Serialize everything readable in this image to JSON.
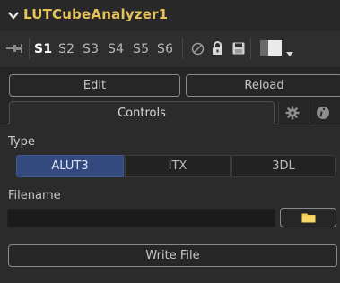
{
  "header": {
    "title": "LUTCubeAnalyzer1"
  },
  "toolbar": {
    "slots": [
      {
        "label": "S1",
        "active": true
      },
      {
        "label": "S2"
      },
      {
        "label": "S3"
      },
      {
        "label": "S4"
      },
      {
        "label": "S5"
      },
      {
        "label": "S6"
      }
    ],
    "icons": [
      "pin-icon",
      "disable-icon",
      "lock-icon",
      "save-icon",
      "color-swatch",
      "dropdown-arrow-icon"
    ],
    "swatch_colors": [
      "#6a6a6a",
      "#eaeaea"
    ]
  },
  "buttons": {
    "edit": "Edit",
    "reload": "Reload",
    "write_file": "Write File"
  },
  "tabs": {
    "controls": "Controls",
    "settings_icon": "gear-icon",
    "info_icon": "info-icon"
  },
  "controls": {
    "type_label": "Type",
    "type_options": [
      "ALUT3",
      "ITX",
      "3DL"
    ],
    "type_selected": "ALUT3",
    "filename_label": "Filename",
    "filename_value": "",
    "browse_icon": "folder-icon"
  },
  "colors": {
    "title": "#e6c35a",
    "accent": "#344a7e",
    "folder": "#f2c94c"
  }
}
